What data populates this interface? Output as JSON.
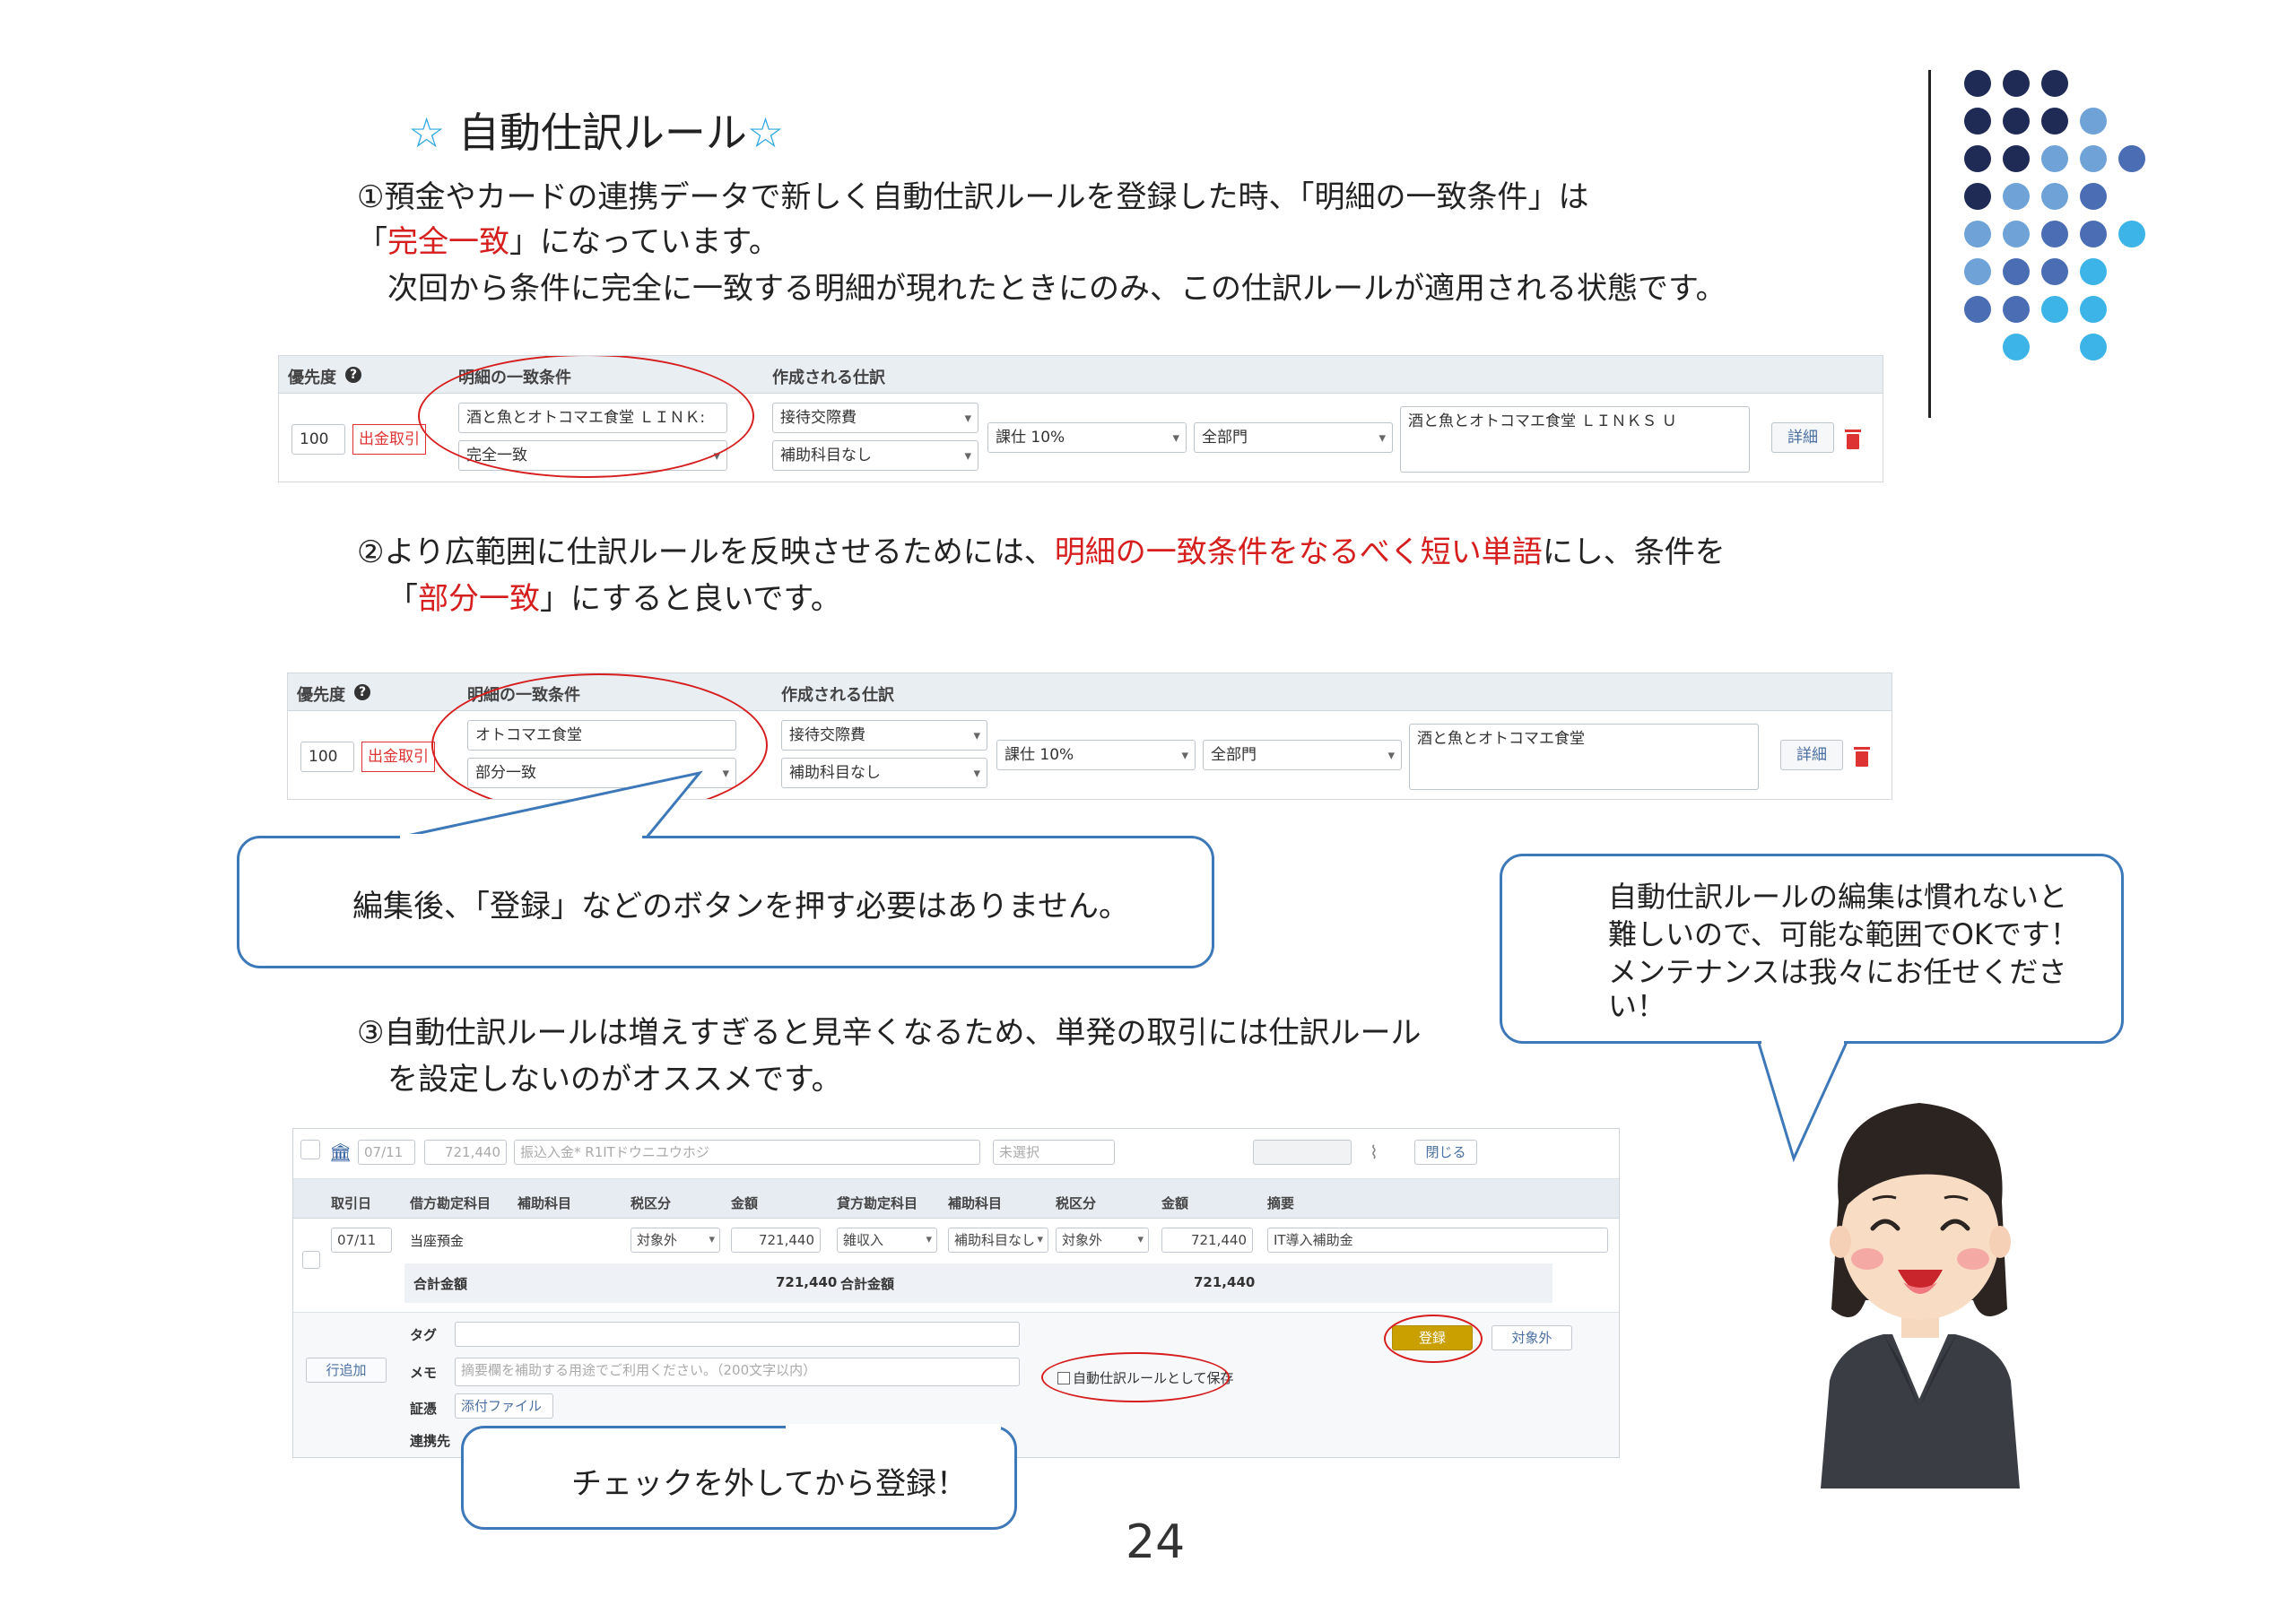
{
  "title": {
    "star_left": "☆",
    "text": " 自動仕訳ルール",
    "star_right": "☆"
  },
  "section1": {
    "line1": "①預金やカードの連携データで新しく自動仕訳ルールを登録した時、「明細の一致条件」は",
    "line2_pre": "「",
    "line2_red": "完全一致",
    "line2_post": "」になっています。",
    "line3": "次回から条件に完全に一致する明細が現れたときにのみ、この仕訳ルールが適用される状態です。"
  },
  "table_headers": {
    "priority": "優先度",
    "condition": "明細の一致条件",
    "journal": "作成される仕訳"
  },
  "rule1": {
    "priority": "100",
    "type": "出金取引",
    "condition_text": "酒と魚とオトコマエ食堂 ＬＩＮＫ:",
    "match_type": "完全一致",
    "account": "接待交際費",
    "sub_account": "補助科目なし",
    "tax": "課仕 10%",
    "dept": "全部門",
    "memo": "酒と魚とオトコマエ食堂 ＬＩＮＫＳ Ｕ",
    "detail_button": "詳細"
  },
  "section2": {
    "line1_pre": "②より広範囲に仕訳ルールを反映させるためには、",
    "line1_red": "明細の一致条件をなるべく短い単語",
    "line1_post": "にし、条件を",
    "line2_pre": "「",
    "line2_red": "部分一致",
    "line2_post": "」にすると良いです。"
  },
  "rule2": {
    "priority": "100",
    "type": "出金取引",
    "condition_text": "オトコマエ食堂",
    "match_type": "部分一致",
    "account": "接待交際費",
    "sub_account": "補助科目なし",
    "tax": "課仕 10%",
    "dept": "全部門",
    "memo": "酒と魚とオトコマエ食堂",
    "detail_button": "詳細"
  },
  "callout1": "編集後、「登録」などのボタンを押す必要はありません。",
  "callout2": {
    "line1": "自動仕訳ルールの編集は慣れないと",
    "line2": "難しいので、可能な範囲でOKです！",
    "line3": "メンテナンスは我々にお任せくださ",
    "line4": "い！"
  },
  "section3": {
    "line1": "③自動仕訳ルールは増えすぎると見辛くなるため、単発の取引には仕訳ルール",
    "line2": "を設定しないのがオススメです。"
  },
  "shot3": {
    "top_date": "07/11",
    "top_amount": "721,440",
    "top_desc": "振込入金* R1ITドウニユウホジ",
    "top_status": "未選択",
    "close_button": "閉じる",
    "headers": [
      "取引日",
      "借方勘定科目",
      "補助科目",
      "税区分",
      "金額",
      "貸方勘定科目",
      "補助科目",
      "税区分",
      "金額",
      "摘要"
    ],
    "row": {
      "date": "07/11",
      "debit_account": "当座預金",
      "debit_tax": "対象外",
      "debit_amount": "721,440",
      "credit_account": "雑収入",
      "credit_sub": "補助科目なし",
      "credit_tax": "対象外",
      "credit_amount": "721,440",
      "memo": "IT導入補助金"
    },
    "total_label_left": "合計金額",
    "total_left": "721,440",
    "total_label_right": "合計金額",
    "total_right": "721,440",
    "tag_label": "タグ",
    "memo_label": "メモ",
    "memo_placeholder": "摘要欄を補助する用途でご利用ください。（200文字以内）",
    "evidence_label": "証憑",
    "attach_button": "添付ファイル",
    "partner_label": "連携先",
    "add_row_button": "行追加",
    "register_button": "登録",
    "exclude_button": "対象外",
    "save_rule_checkbox": "自動仕訳ルールとして保存"
  },
  "callout3": "チェックを外してから登録！",
  "page_number": "24",
  "colors": {
    "dark_navy": "#1f2a55",
    "mid_blue": "#4a6db3",
    "light_blue": "#6fa3d8",
    "cyan": "#3cb4e8",
    "red": "#d61e1e",
    "callout_border": "#3d78b8"
  }
}
